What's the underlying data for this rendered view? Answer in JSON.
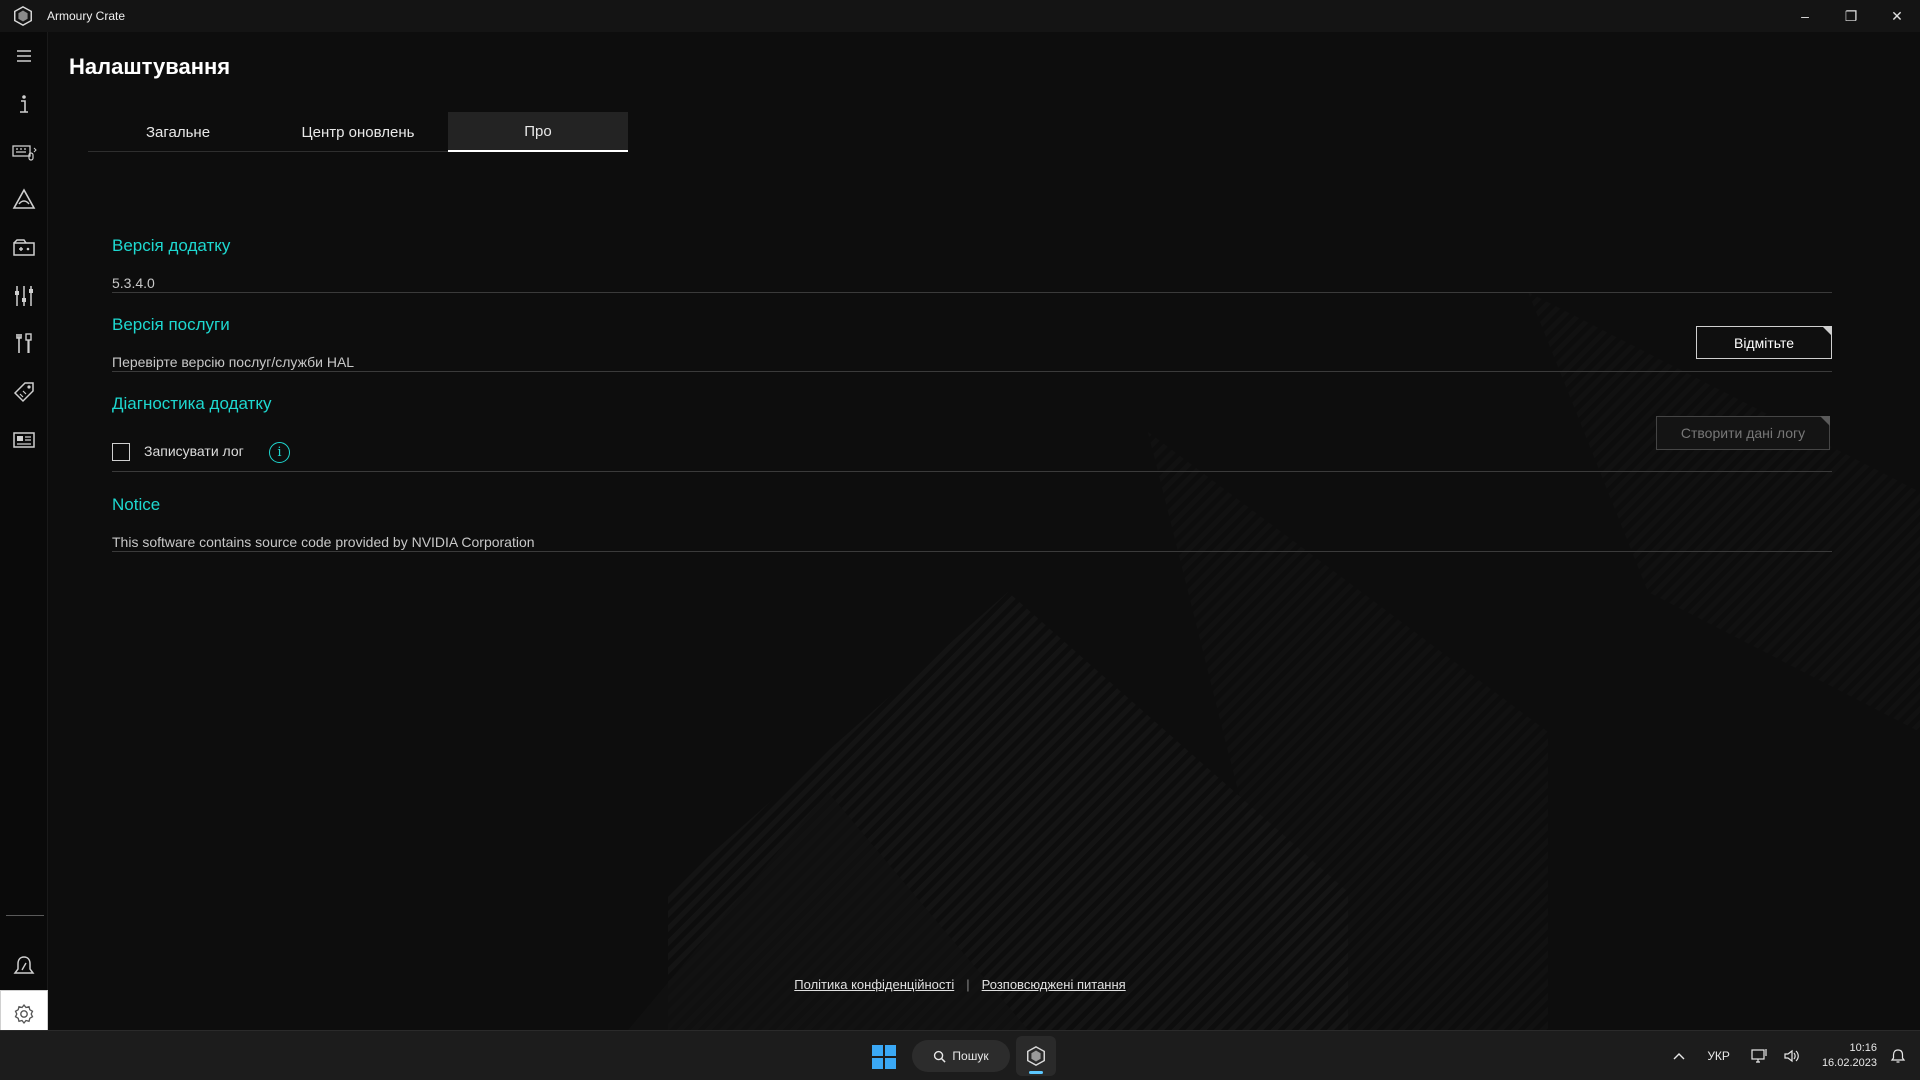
{
  "window": {
    "title": "Armoury Crate",
    "controls": [
      "–",
      "❐",
      "✕"
    ]
  },
  "sidebar": {
    "items": [
      {
        "name": "menu-icon"
      },
      {
        "name": "home-info-icon"
      },
      {
        "name": "device-icon"
      },
      {
        "name": "aura-icon"
      },
      {
        "name": "game-library-icon"
      },
      {
        "name": "scenario-profiles-icon"
      },
      {
        "name": "tools-icon"
      },
      {
        "name": "deals-icon"
      },
      {
        "name": "news-icon"
      },
      {
        "name": "user-center-icon"
      },
      {
        "name": "settings-icon"
      }
    ]
  },
  "page": {
    "title": "Налаштування",
    "tabs": [
      {
        "label": "Загальне",
        "active": false
      },
      {
        "label": "Центр оновлень",
        "active": false
      },
      {
        "label": "Про",
        "active": true
      }
    ]
  },
  "about": {
    "app_version": {
      "title": "Версія додатку",
      "value": "5.3.4.0"
    },
    "service_version": {
      "title": "Версія послуги",
      "text": "Перевірте версію послуг/служби HAL",
      "button": "Відмітьте"
    },
    "diagnostics": {
      "title": "Діагностика додатку",
      "checkbox_label": "Записувати лог",
      "checked": false,
      "button": "Створити дані логу"
    },
    "notice": {
      "title": "Notice",
      "text": "This software contains source code provided by NVIDIA Corporation"
    }
  },
  "footer": {
    "privacy_link": "Політика конфіденційності",
    "separator": "|",
    "faq_link": "Розповсюджені питання"
  },
  "taskbar": {
    "search_label": "Пошук",
    "language": "УКР",
    "time": "10:16",
    "date": "16.02.2023"
  },
  "colors": {
    "accent": "#1ed8d0",
    "background": "#0d0d0d",
    "sidebar": "#0a0a0a",
    "taskbar": "#1c1c1c"
  }
}
